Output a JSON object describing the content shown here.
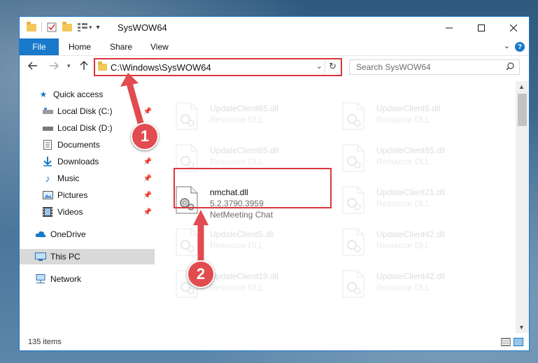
{
  "window": {
    "title": "SysWOW64"
  },
  "ribbon": {
    "tabs": [
      "File",
      "Home",
      "Share",
      "View"
    ]
  },
  "address": {
    "path": "C:\\Windows\\SysWOW64"
  },
  "search": {
    "placeholder": "Search SysWOW64"
  },
  "nav": {
    "items": [
      {
        "label": "Quick access",
        "icon": "star-icon"
      },
      {
        "label": "Local Disk (C:)",
        "icon": "disk-icon"
      },
      {
        "label": "Local Disk (D:)",
        "icon": "disk-icon"
      },
      {
        "label": "Documents",
        "icon": "document-icon"
      },
      {
        "label": "Downloads",
        "icon": "download-icon"
      },
      {
        "label": "Music",
        "icon": "music-icon"
      },
      {
        "label": "Pictures",
        "icon": "picture-icon"
      },
      {
        "label": "Videos",
        "icon": "video-icon"
      },
      {
        "label": "OneDrive",
        "icon": "cloud-icon"
      },
      {
        "label": "This PC",
        "icon": "computer-icon"
      },
      {
        "label": "Network",
        "icon": "network-icon"
      }
    ]
  },
  "files": {
    "left": [
      {
        "name": "UpdateClient65.dll",
        "type": "Resource DLL"
      },
      {
        "name": "UpdateClient65.dll",
        "type": "Resource DLL"
      },
      {
        "name": "nmchat.dll",
        "version": "5.2.3790.3959",
        "description": "NetMeeting Chat"
      },
      {
        "name": "UpdateClient5.dll",
        "type": "Resource DLL"
      },
      {
        "name": "UpdateClient19.dll",
        "type": "Resource DLL"
      }
    ],
    "right": [
      {
        "name": "UpdateClient5.dll",
        "type": "Resource DLL"
      },
      {
        "name": "UpdateClient65.dll",
        "type": "Resource DLL"
      },
      {
        "name": "UpdateClient21.dll",
        "type": "Resource DLL"
      },
      {
        "name": "UpdateClient42.dll",
        "type": "Resource DLL"
      },
      {
        "name": "UpdateClient42.dll",
        "type": "Resource DLL"
      }
    ]
  },
  "status": {
    "items_count": "135 items"
  },
  "annotations": {
    "step1": "1",
    "step2": "2"
  },
  "colors": {
    "accent": "#1979ca",
    "highlight": "#d9363e",
    "badge": "#e24b4f"
  }
}
